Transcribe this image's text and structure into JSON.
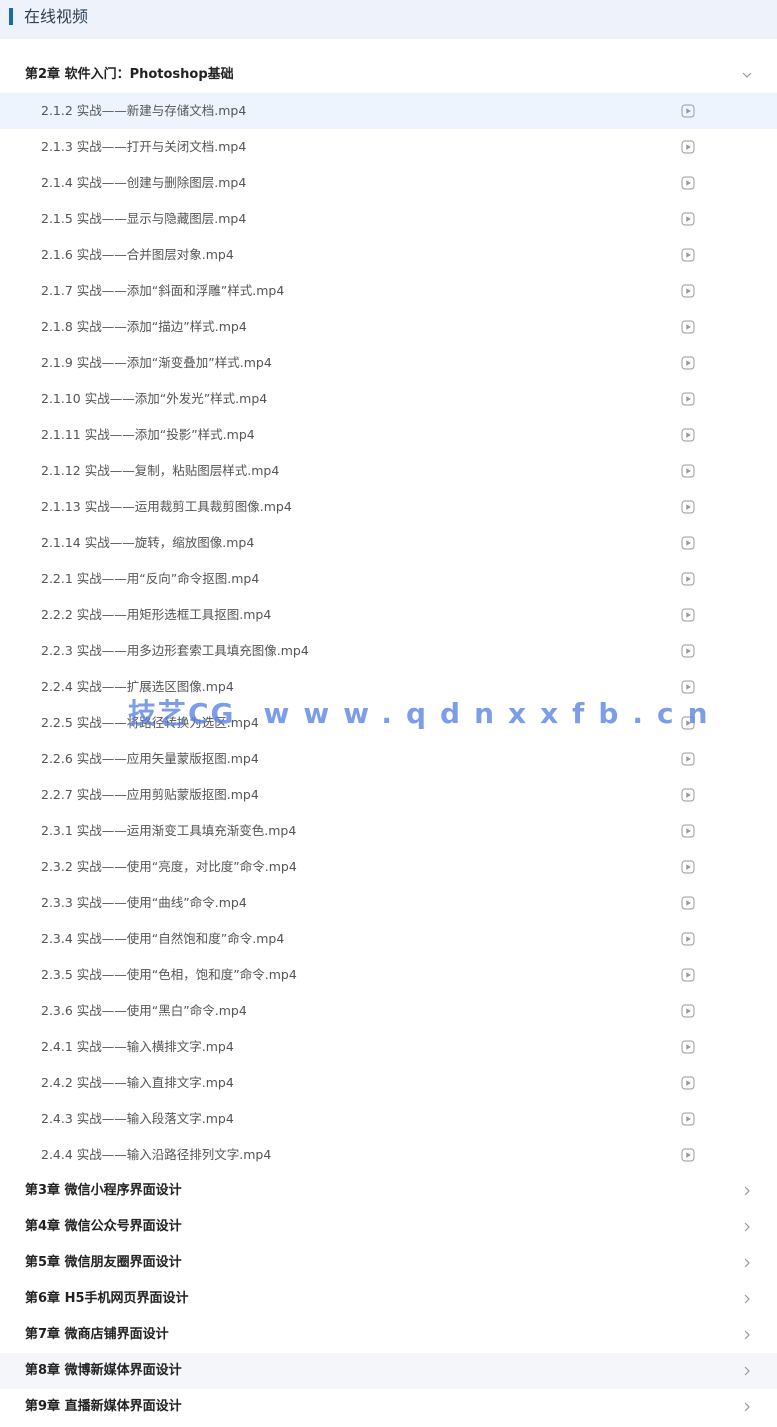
{
  "header": {
    "title": "在线视频"
  },
  "expanded_chapter": {
    "title": "第2章 软件入门：Photoshop基础"
  },
  "lessons": [
    "2.1.2 实战——新建与存储文档.mp4",
    "2.1.3 实战——打开与关闭文档.mp4",
    "2.1.4 实战——创建与删除图层.mp4",
    "2.1.5 实战——显示与隐藏图层.mp4",
    "2.1.6 实战——合并图层对象.mp4",
    "2.1.7 实战——添加“斜面和浮雕”样式.mp4",
    "2.1.8 实战——添加“描边”样式.mp4",
    "2.1.9 实战——添加“渐变叠加”样式.mp4",
    "2.1.10 实战——添加“外发光”样式.mp4",
    "2.1.11 实战——添加“投影”样式.mp4",
    "2.1.12 实战——复制，粘贴图层样式.mp4",
    "2.1.13 实战——运用裁剪工具裁剪图像.mp4",
    "2.1.14 实战——旋转，缩放图像.mp4",
    "2.2.1 实战——用“反向”命令抠图.mp4",
    "2.2.2 实战——用矩形选框工具抠图.mp4",
    "2.2.3 实战——用多边形套索工具填充图像.mp4",
    "2.2.4 实战——扩展选区图像.mp4",
    "2.2.5 实战——将路径转换为选区.mp4",
    "2.2.6 实战——应用矢量蒙版抠图.mp4",
    "2.2.7 实战——应用剪贴蒙版抠图.mp4",
    "2.3.1 实战——运用渐变工具填充渐变色.mp4",
    "2.3.2 实战——使用“亮度，对比度”命令.mp4",
    "2.3.3 实战——使用“曲线”命令.mp4",
    "2.3.4 实战——使用“自然饱和度”命令.mp4",
    "2.3.5 实战——使用“色相，饱和度”命令.mp4",
    "2.3.6 实战——使用“黑白”命令.mp4",
    "2.4.1 实战——输入横排文字.mp4",
    "2.4.2 实战——输入直排文字.mp4",
    "2.4.3 实战——输入段落文字.mp4",
    "2.4.4 实战——输入沿路径排列文字.mp4"
  ],
  "chapters": [
    "第3章 微信小程序界面设计",
    "第4章 微信公众号界面设计",
    "第5章 微信朋友圈界面设计",
    "第6章 H5手机网页界面设计",
    "第7章 微商店铺界面设计",
    "第8章 微博新媒体界面设计",
    "第9章 直播新媒体界面设计"
  ],
  "watermark": {
    "brand": "技艺CG",
    "url": "www.qdnxxfb.cn"
  },
  "colors": {
    "accent": "#1a6aa8",
    "header_bg": "#eef3fb",
    "active_row_bg": "#eef4fd",
    "hover_row_bg": "#f4f6fa",
    "watermark": "#5a82e1"
  },
  "icons": {
    "lesson": "play-circle-icon",
    "expanded": "chevron-down-icon",
    "collapsed": "chevron-right-icon"
  }
}
